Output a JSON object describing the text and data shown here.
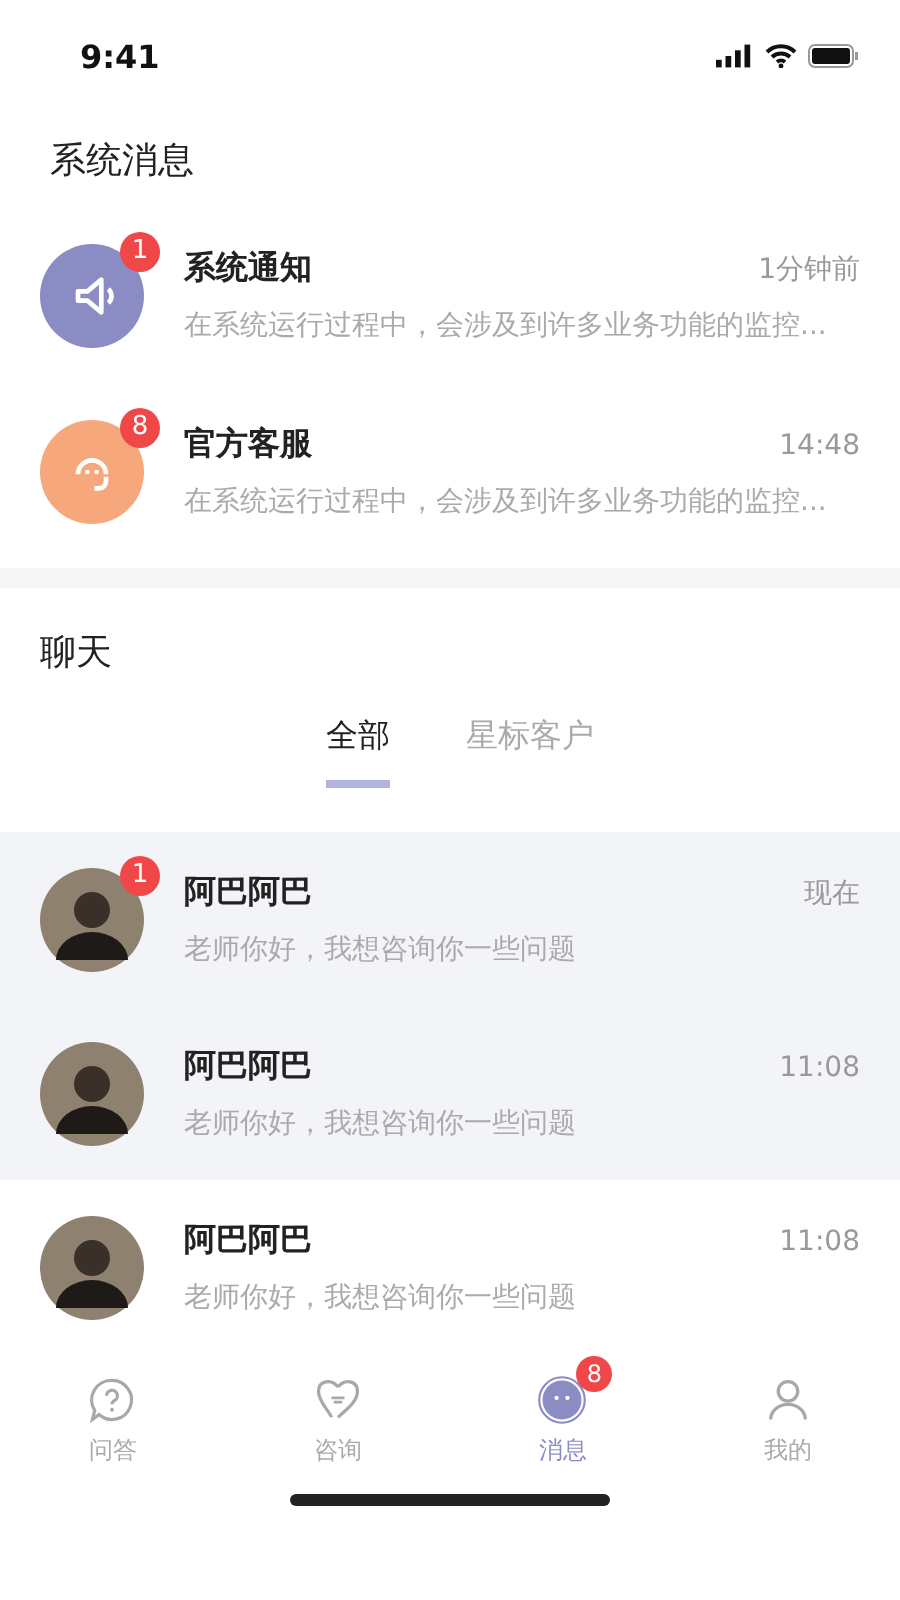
{
  "status_bar": {
    "time": "9:41"
  },
  "system_section": {
    "title": "系统消息",
    "items": [
      {
        "kind": "speaker",
        "title": "系统通知",
        "time": "1分钟前",
        "preview": "在系统运行过程中，会涉及到许多业务功能的监控...",
        "badge": "1",
        "color": "#8a8cc3"
      },
      {
        "kind": "headset",
        "title": "官方客服",
        "time": "14:48",
        "preview": "在系统运行过程中，会涉及到许多业务功能的监控...",
        "badge": "8",
        "color": "#f7a77c"
      }
    ]
  },
  "chat_section": {
    "title": "聊天",
    "tabs": [
      {
        "label": "全部",
        "selected": true
      },
      {
        "label": "星标客户",
        "selected": false
      }
    ],
    "pinned_items": [
      {
        "name": "阿巴阿巴",
        "time": "现在",
        "preview": "老师你好，我想咨询你一些问题",
        "badge": "1"
      },
      {
        "name": "阿巴阿巴",
        "time": "11:08",
        "preview": "老师你好，我想咨询你一些问题"
      }
    ],
    "items": [
      {
        "name": "阿巴阿巴",
        "time": "11:08",
        "preview": "老师你好，我想咨询你一些问题"
      }
    ]
  },
  "tab_bar": [
    {
      "kind": "question",
      "label": "问答",
      "selected": false
    },
    {
      "kind": "heart",
      "label": "咨询",
      "selected": false
    },
    {
      "kind": "message",
      "label": "消息",
      "selected": true,
      "badge": "8"
    },
    {
      "kind": "person",
      "label": "我的",
      "selected": false
    }
  ]
}
